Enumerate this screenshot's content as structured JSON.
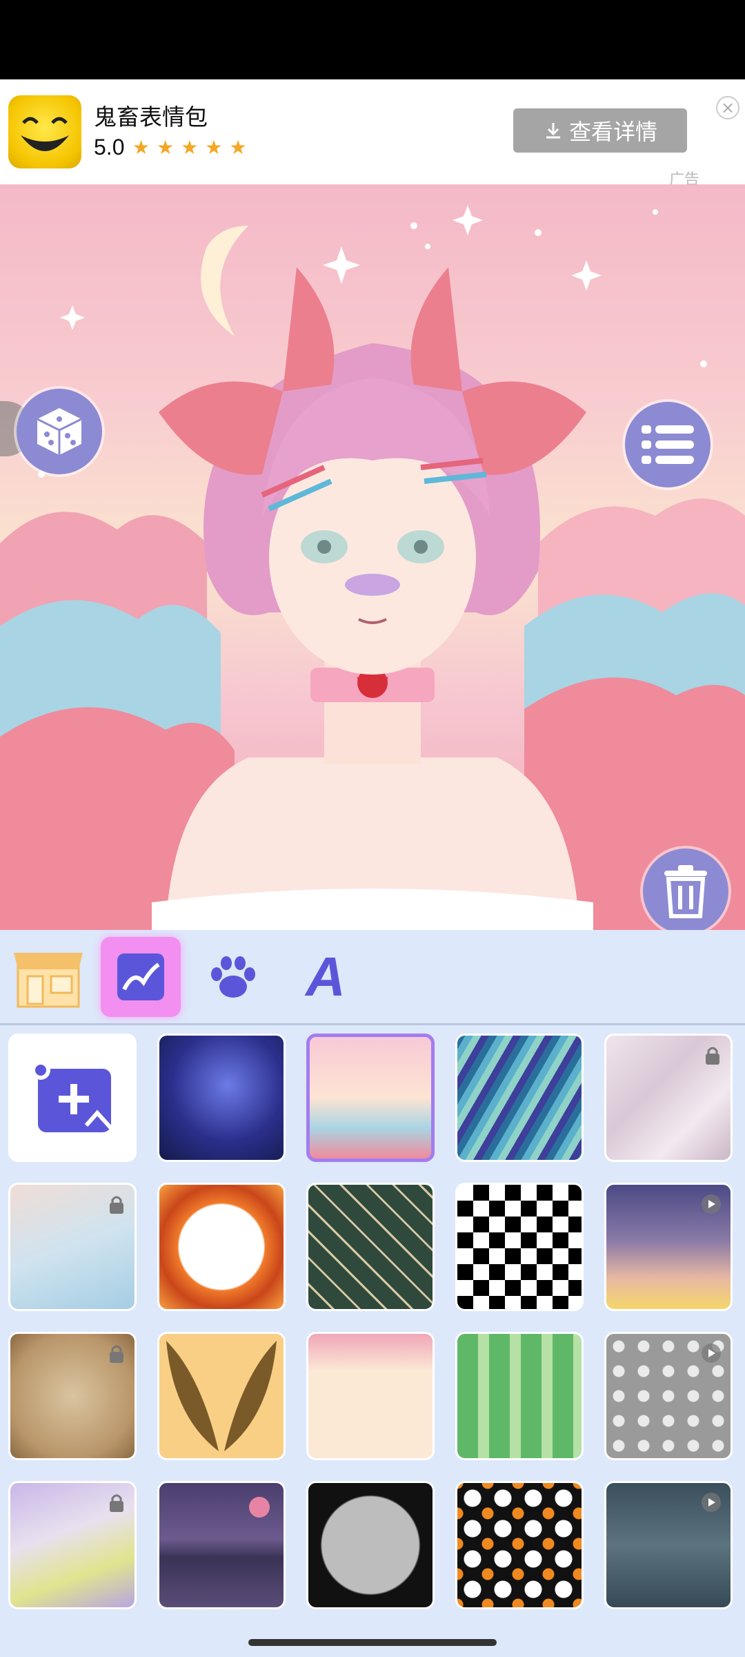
{
  "ad": {
    "app_name": "鬼畜表情包",
    "rating": "5.0",
    "stars": [
      "★",
      "★",
      "★",
      "★",
      "★"
    ],
    "button_label": "查看详情",
    "close_glyph": "×",
    "ad_label": "广告"
  },
  "toolbar": {
    "icons": [
      "dice-icon",
      "list-menu-icon",
      "trash-icon",
      "double-chevron-left-icon"
    ]
  },
  "tabs": [
    {
      "name": "shop",
      "icon": "shop-icon",
      "active": false
    },
    {
      "name": "background",
      "icon": "background-image-icon",
      "active": true
    },
    {
      "name": "pet",
      "icon": "paw-icon",
      "active": false
    },
    {
      "name": "text",
      "icon": "letter-a-icon",
      "active": false
    }
  ],
  "text_tab_label": "A",
  "backgrounds": [
    {
      "id": "add",
      "type": "add-photo",
      "lock": false,
      "video": false
    },
    {
      "id": "galaxy",
      "type": "image",
      "lock": false,
      "video": false
    },
    {
      "id": "pastel-clouds",
      "type": "image",
      "lock": false,
      "video": false,
      "selected": true
    },
    {
      "id": "blue-swirl",
      "type": "image",
      "lock": false,
      "video": false
    },
    {
      "id": "marble",
      "type": "image",
      "lock": true,
      "video": false
    },
    {
      "id": "watercolor",
      "type": "image",
      "lock": true,
      "video": false
    },
    {
      "id": "orange-frame",
      "type": "image",
      "lock": false,
      "video": false
    },
    {
      "id": "green-pattern",
      "type": "image",
      "lock": false,
      "video": false
    },
    {
      "id": "checkerboard",
      "type": "image",
      "lock": false,
      "video": false
    },
    {
      "id": "sunset-sky",
      "type": "image",
      "lock": false,
      "video": true
    },
    {
      "id": "old-paper",
      "type": "image",
      "lock": true,
      "video": false
    },
    {
      "id": "wings",
      "type": "image",
      "lock": false,
      "video": false
    },
    {
      "id": "floral",
      "type": "image",
      "lock": false,
      "video": false
    },
    {
      "id": "leaves",
      "type": "image",
      "lock": false,
      "video": false
    },
    {
      "id": "skulls",
      "type": "image",
      "lock": false,
      "video": true
    },
    {
      "id": "paint-splash",
      "type": "image",
      "lock": true,
      "video": false
    },
    {
      "id": "purple-lake",
      "type": "image",
      "lock": false,
      "video": false
    },
    {
      "id": "halloween-frame",
      "type": "image",
      "lock": false,
      "video": false
    },
    {
      "id": "ghosts",
      "type": "image",
      "lock": false,
      "video": false
    },
    {
      "id": "night-sky",
      "type": "image",
      "lock": false,
      "video": true
    }
  ],
  "colors": {
    "accent_purple": "#8c8ad3",
    "tab_active": "#f28ff0",
    "panel_bg": "#dde8fa",
    "selected_border": "#a37cf0"
  }
}
